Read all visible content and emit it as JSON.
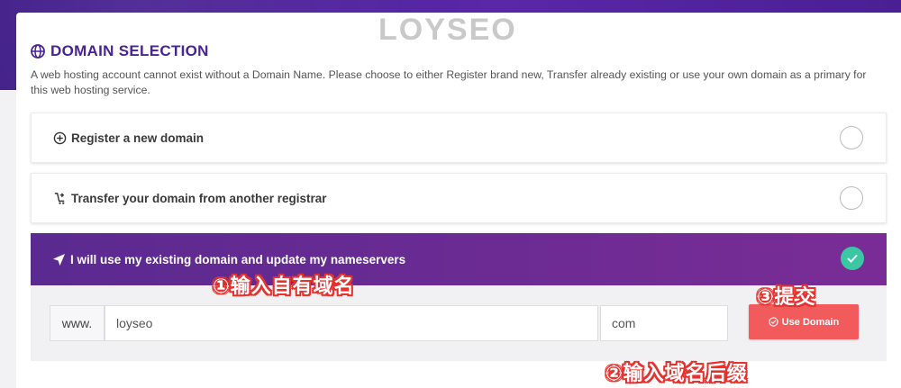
{
  "watermark": "LOYSEO",
  "section": {
    "title": "DOMAIN SELECTION",
    "description": "A web hosting account cannot exist without a Domain Name. Please choose to either Register brand new, Transfer already existing or use your own domain as a primary for this web hosting service."
  },
  "options": [
    {
      "label": "Register a new domain",
      "icon": "plus-circle-icon",
      "selected": false
    },
    {
      "label": "Transfer your domain from another registrar",
      "icon": "transfer-cart-icon",
      "selected": false
    },
    {
      "label": "I will use my existing domain and update my nameservers",
      "icon": "send-arrow-icon",
      "selected": true
    }
  ],
  "domain_form": {
    "prefix": "www.",
    "domain_value": "loyseo",
    "tld_value": "com",
    "submit_label": "Use Domain"
  },
  "annotations": {
    "step1": "①输入自有域名",
    "step2": "②输入域名后缀",
    "step3": "③提交"
  },
  "colors": {
    "brand_purple": "#4a2394",
    "active_option": "#6a2b93",
    "check_green": "#3cc7a4",
    "submit_red": "#f15b5b",
    "annotation_red": "#e6322e"
  }
}
